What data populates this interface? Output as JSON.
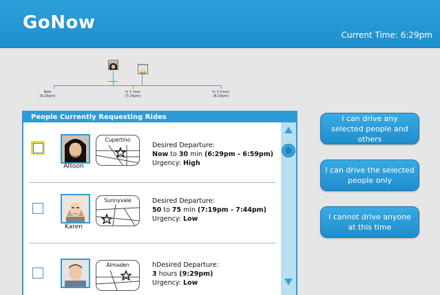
{
  "app": {
    "title": "GoNow",
    "current_time": "Current Time: 6:29pm"
  },
  "timeline": {
    "ticks": [
      {
        "label": "Now",
        "sub": "(6:29pm)"
      },
      {
        "label": "in 1 hour",
        "sub": "(7:29pm)"
      },
      {
        "label": "in 2 hours",
        "sub": "(8:29pm)"
      }
    ]
  },
  "panel": {
    "title": "People Currently Requesting Rides",
    "requests": [
      {
        "name": "Allison",
        "city": "Cupertino",
        "selected": true,
        "departure_label": "Desired Departure:",
        "departure_from": "Now",
        "departure_to_word": " to ",
        "departure_to": "30",
        "departure_unit": " min ",
        "departure_times": "(6:29pm - 6:59pm)",
        "urgency_label": "Urgency: ",
        "urgency": "High"
      },
      {
        "name": "Karen",
        "city": "Sunnyvale",
        "selected": false,
        "departure_label": "Desired Departure:",
        "departure_from": "50",
        "departure_to_word": " to ",
        "departure_to": "75",
        "departure_unit": " min ",
        "departure_times": "(7:19pm - 7:44pm)",
        "urgency_label": "Urgency: ",
        "urgency": "Low"
      },
      {
        "name": "",
        "city": "Almaden",
        "selected": false,
        "departure_label": "hDesired Departure:",
        "departure_from": "3",
        "departure_to_word": "",
        "departure_to": "",
        "departure_unit": " hours ",
        "departure_times": "(9:29pm)",
        "urgency_label": "Urgency: ",
        "urgency": "Low"
      }
    ]
  },
  "actions": {
    "drive_selected_and_others": "I can drive any selected people and others",
    "drive_selected_only": "I can drive the selected people only",
    "cannot_drive": "I cannot drive anyone at this time"
  },
  "colors": {
    "header": "#2d9fd9",
    "accent": "#2e9bd6",
    "selected_highlight": "#e6d94c"
  }
}
